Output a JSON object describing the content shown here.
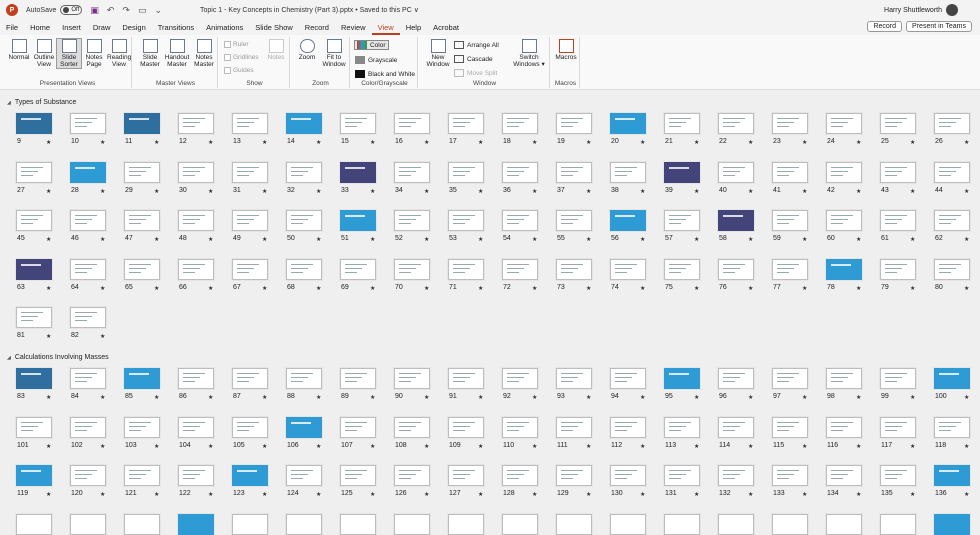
{
  "titlebar": {
    "autosave_label": "AutoSave",
    "autosave_state": "Off",
    "title": "Topic 1 - Key Concepts in Chemistry (Part 3).pptx  •  Saved to this PC  ∨",
    "user": "Harry Shuttleworth",
    "icons": [
      "save-icon",
      "undo-icon",
      "redo-icon",
      "present-icon",
      "search-icon"
    ]
  },
  "menu": {
    "items": [
      "File",
      "Home",
      "Insert",
      "Draw",
      "Design",
      "Transitions",
      "Animations",
      "Slide Show",
      "Record",
      "Review",
      "View",
      "Help",
      "Acrobat"
    ],
    "active": "View",
    "record_label": "Record",
    "present_label": "Present in Teams"
  },
  "ribbon": {
    "presentation_views": {
      "label": "Presentation Views",
      "buttons": [
        "Normal",
        "Outline View",
        "Slide Sorter",
        "Notes Page",
        "Reading View"
      ]
    },
    "master_views": {
      "label": "Master Views",
      "buttons": [
        "Slide Master",
        "Handout Master",
        "Notes Master"
      ]
    },
    "show": {
      "label": "Show",
      "checks": [
        "Ruler",
        "Gridlines",
        "Guides"
      ],
      "notes_label": "Notes"
    },
    "zoom": {
      "label": "Zoom",
      "buttons": [
        "Zoom",
        "Fit to Window"
      ]
    },
    "color": {
      "label": "Color/Grayscale",
      "items": [
        "Color",
        "Grayscale",
        "Black and White"
      ]
    },
    "window": {
      "label": "Window",
      "new_window": "New Window",
      "items": [
        "Arrange All",
        "Cascade",
        "Move Split"
      ],
      "switch": "Switch Windows ▾"
    },
    "macros": {
      "label": "Macros",
      "button": "Macros"
    }
  },
  "sections": [
    {
      "title": "Types of Substance",
      "first": 9,
      "last": 82
    },
    {
      "title": "Calculations Involving Masses",
      "first": 83,
      "last": 136
    }
  ],
  "colored_slides": {
    "blue": [
      14,
      20,
      28,
      51,
      56,
      78,
      85,
      95,
      100,
      106,
      119,
      123,
      136
    ],
    "navy": [
      33,
      39,
      58,
      63
    ],
    "dkblue": [
      9,
      11,
      83
    ]
  }
}
